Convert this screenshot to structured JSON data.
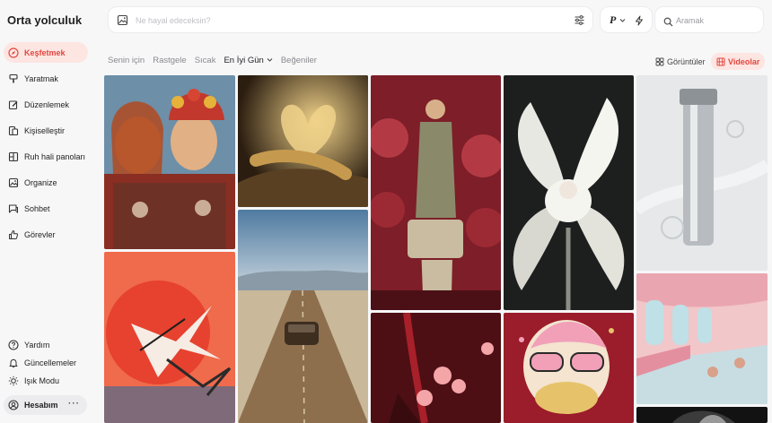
{
  "app": {
    "title": "Orta yolculuk"
  },
  "sidebar": {
    "items": [
      {
        "label": "Keşfetmek",
        "icon": "compass-icon",
        "active": true
      },
      {
        "label": "Yaratmak",
        "icon": "brush-icon"
      },
      {
        "label": "Düzenlemek",
        "icon": "edit-icon"
      },
      {
        "label": "Kişiselleştir",
        "icon": "personalize-icon"
      },
      {
        "label": "Ruh hali panoları",
        "icon": "moodboard-icon"
      },
      {
        "label": "Organize",
        "icon": "image-icon"
      },
      {
        "label": "Sohbet",
        "icon": "chat-icon"
      },
      {
        "label": "Görevler",
        "icon": "thumbs-up-icon"
      }
    ],
    "bottom": [
      {
        "label": "Yardım",
        "icon": "help-icon"
      },
      {
        "label": "Güncellemeler",
        "icon": "bell-icon"
      },
      {
        "label": "Işık Modu",
        "icon": "sun-icon"
      }
    ],
    "account": {
      "label": "Hesabım",
      "more": "···"
    }
  },
  "search": {
    "placeholder": "Ne hayal edeceksin?"
  },
  "mode": {
    "letter": "P"
  },
  "rightsearch": {
    "placeholder": "Aramak"
  },
  "tabs": [
    "Senin için",
    "Rastgele",
    "Sıcak",
    "En İyi Gün",
    "Beğeniler"
  ],
  "view": {
    "images": "Görüntüler",
    "videos": "Videolar"
  },
  "colors": {
    "accent": "#e2473f",
    "accent_bg": "#fde5e2"
  },
  "gallery": [
    {
      "name": "gallery-image-folk-portrait",
      "colors": [
        "#8a2d22",
        "#d9a26b",
        "#6d8fa8",
        "#3a3a2e"
      ]
    },
    {
      "name": "gallery-image-golden-butterflies",
      "colors": [
        "#2b1d10",
        "#c69a4e",
        "#f0d28a",
        "#5a4022"
      ]
    },
    {
      "name": "gallery-image-embroidered-figure",
      "colors": [
        "#7d1e28",
        "#b33a45",
        "#c9bca0",
        "#4a1016"
      ]
    },
    {
      "name": "gallery-image-white-lily",
      "colors": [
        "#1d1f1f",
        "#e8e8e2",
        "#8a8f86",
        "#f5f5f0"
      ]
    },
    {
      "name": "gallery-image-silver-bottle",
      "colors": [
        "#e6e8ea",
        "#b8bcc0",
        "#f4f5f6",
        "#8d9296"
      ]
    },
    {
      "name": "gallery-image-desert-road",
      "colors": [
        "#6f93b3",
        "#c9b89a",
        "#8d6f4e",
        "#3d2e20"
      ]
    },
    {
      "name": "gallery-image-cranes-sun",
      "colors": [
        "#f06a4c",
        "#e6422f",
        "#f3b9a4",
        "#5a6b8a"
      ]
    },
    {
      "name": "gallery-image-pink-train",
      "colors": [
        "#f1c7c9",
        "#e48fa0",
        "#bfe0e6",
        "#d9a08a"
      ]
    },
    {
      "name": "gallery-image-red-drinks",
      "colors": [
        "#4d0f14",
        "#a8202a",
        "#f4a5a8",
        "#2c0a0c"
      ]
    },
    {
      "name": "gallery-image-donut-character",
      "colors": [
        "#9b1c2a",
        "#f1a0b8",
        "#e6c36a",
        "#f4e4d0"
      ]
    },
    {
      "name": "gallery-image-dark-partial",
      "colors": [
        "#121212",
        "#3b3b3b",
        "#d8d8d8",
        "#222222"
      ]
    }
  ]
}
